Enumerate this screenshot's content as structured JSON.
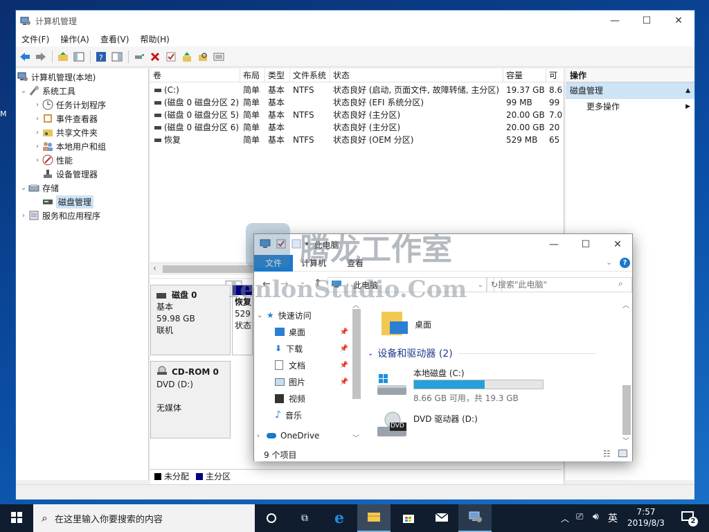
{
  "desktop": {
    "edge_label": "M"
  },
  "mmc": {
    "title": "计算机管理",
    "menu": [
      "文件(F)",
      "操作(A)",
      "查看(V)",
      "帮助(H)"
    ],
    "tree": [
      {
        "label": "计算机管理(本地)",
        "icon": "computer-icon"
      },
      {
        "label": "系统工具",
        "icon": "tools-icon"
      },
      {
        "label": "任务计划程序",
        "icon": "clock-icon"
      },
      {
        "label": "事件查看器",
        "icon": "event-viewer-icon"
      },
      {
        "label": "共享文件夹",
        "icon": "shared-folder-icon"
      },
      {
        "label": "本地用户和组",
        "icon": "users-icon"
      },
      {
        "label": "性能",
        "icon": "performance-icon"
      },
      {
        "label": "设备管理器",
        "icon": "device-manager-icon"
      },
      {
        "label": "存储",
        "icon": "storage-icon"
      },
      {
        "label": "磁盘管理",
        "icon": "disk-management-icon"
      },
      {
        "label": "服务和应用程序",
        "icon": "services-icon"
      }
    ],
    "columns": [
      "卷",
      "布局",
      "类型",
      "文件系统",
      "状态",
      "容量",
      "可"
    ],
    "volumes": [
      [
        "(C:)",
        "简单",
        "基本",
        "NTFS",
        "状态良好 (启动, 页面文件, 故障转储, 主分区)",
        "19.37 GB",
        "8.6"
      ],
      [
        "(磁盘 0 磁盘分区 2)",
        "简单",
        "基本",
        "",
        "状态良好 (EFI 系统分区)",
        "99 MB",
        "99"
      ],
      [
        "(磁盘 0 磁盘分区 5)",
        "简单",
        "基本",
        "NTFS",
        "状态良好 (主分区)",
        "20.00 GB",
        "7.0"
      ],
      [
        "(磁盘 0 磁盘分区 6)",
        "简单",
        "基本",
        "",
        "状态良好 (主分区)",
        "20.00 GB",
        "20"
      ],
      [
        "恢复",
        "简单",
        "基本",
        "NTFS",
        "状态良好 (OEM 分区)",
        "529 MB",
        "65"
      ]
    ],
    "disk0": {
      "name": "磁盘 0",
      "type": "基本",
      "size": "59.98 GB",
      "status": "联机",
      "partition_name": "恢复",
      "partition_size": "529",
      "partition_status": "状态"
    },
    "cdrom": {
      "name": "CD-ROM 0",
      "drive": "DVD (D:)",
      "media": "无媒体"
    },
    "legend": {
      "unallocated": "未分配",
      "primary": "主分区",
      "unallocated_color": "#000000",
      "primary_color": "#00007f"
    },
    "actions": {
      "header": "操作",
      "section": "磁盘管理",
      "more": "更多操作"
    }
  },
  "explorer": {
    "title": "此电脑",
    "tabs": [
      "文件",
      "计算机",
      "查看"
    ],
    "address": "此电脑",
    "search_placeholder": "搜索\"此电脑\"",
    "nav": {
      "quick_access": "快速访问",
      "items": [
        "桌面",
        "下载",
        "文档",
        "图片",
        "视频",
        "音乐"
      ],
      "onedrive": "OneDrive"
    },
    "content": {
      "folder": "桌面",
      "group": "设备和驱动器 (2)",
      "c_name": "本地磁盘 (C:)",
      "c_free": "8.66 GB 可用，共 19.3 GB",
      "c_used_fraction": 0.55,
      "d_name": "DVD 驱动器 (D:)",
      "dvd_badge": "DVD"
    },
    "status": "9 个项目"
  },
  "taskbar": {
    "search_placeholder": "在这里输入你要搜索的内容",
    "ime": "英",
    "time": "7:57",
    "date": "2019/8/3",
    "notifications": "2"
  },
  "watermark": {
    "line1": "腾龙工作室",
    "line2": "TenlonStudio.Com"
  }
}
